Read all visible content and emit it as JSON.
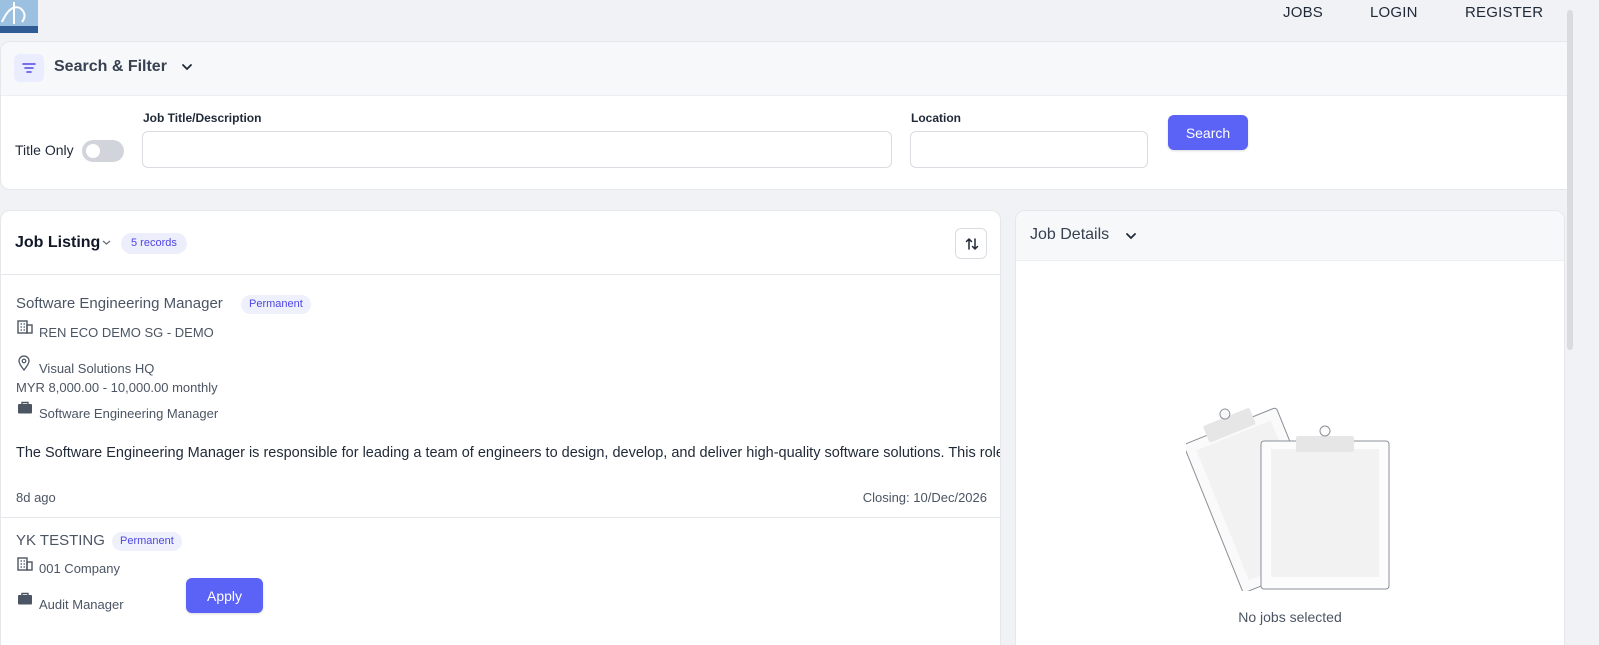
{
  "nav": {
    "links": [
      "JOBS",
      "LOGIN",
      "REGISTER"
    ]
  },
  "filter": {
    "title": "Search & Filter",
    "title_only_label": "Title Only",
    "title_only_on": false,
    "job_title_label": "Job Title/Description",
    "job_title_value": "",
    "location_label": "Location",
    "location_value": "",
    "search_label": "Search"
  },
  "listing": {
    "title": "Job Listing",
    "records_badge": "5 records",
    "jobs": [
      {
        "title": "Software Engineering Manager",
        "type": "Permanent",
        "company": "REN ECO DEMO SG - DEMO",
        "location": "Visual Solutions HQ",
        "salary": "MYR 8,000.00 - 10,000.00 monthly",
        "position": "Software Engineering Manager",
        "description": "The Software Engineering Manager is responsible for leading a team of engineers to design, develop, and deliver high-quality software solutions. This role",
        "posted": "8d ago",
        "closing": "Closing: 10/Dec/2026"
      },
      {
        "title": "YK TESTING",
        "type": "Permanent",
        "company": "001 Company",
        "position": "Audit Manager",
        "apply_label": "Apply"
      }
    ]
  },
  "details": {
    "title": "Job Details",
    "empty_text": "No jobs selected"
  },
  "colors": {
    "accent": "#5b62f6",
    "badge_bg": "#eef0fb",
    "badge_text": "#4f46e5",
    "page_bg": "#f1f2f5"
  },
  "icons": {
    "filter": "filter-lines-icon",
    "chevron": "chevron-down-icon",
    "sort": "sort-arrows-icon",
    "company": "building-icon",
    "location": "map-pin-icon",
    "position": "briefcase-icon"
  }
}
